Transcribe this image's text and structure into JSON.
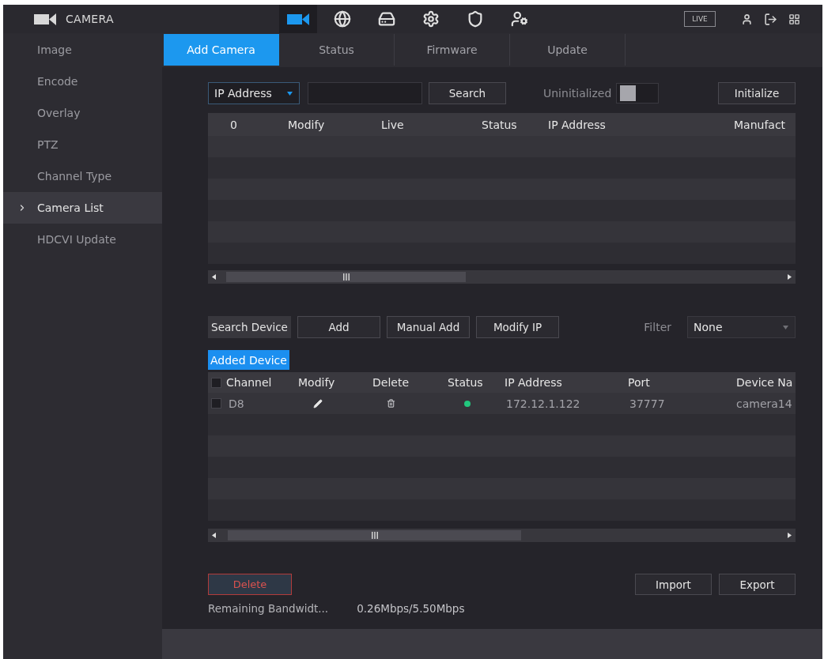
{
  "top_bar": {
    "title": "CAMERA",
    "nav": [
      {
        "kind": "camera",
        "selected": true
      },
      {
        "kind": "network",
        "selected": false
      },
      {
        "kind": "storage",
        "selected": false
      },
      {
        "kind": "system",
        "selected": false
      },
      {
        "kind": "security",
        "selected": false
      },
      {
        "kind": "account",
        "selected": false
      }
    ],
    "live_button": "LIVE"
  },
  "sidebar": {
    "items": [
      {
        "label": "Image",
        "selected": false
      },
      {
        "label": "Encode",
        "selected": false
      },
      {
        "label": "Overlay",
        "selected": false
      },
      {
        "label": "PTZ",
        "selected": false
      },
      {
        "label": "Channel Type",
        "selected": false
      },
      {
        "label": "Camera List",
        "selected": true
      },
      {
        "label": "HDCVI Update",
        "selected": false
      }
    ]
  },
  "tabs": [
    {
      "label": "Add Camera",
      "selected": true
    },
    {
      "label": "Status",
      "selected": false
    },
    {
      "label": "Firmware",
      "selected": false
    },
    {
      "label": "Update",
      "selected": false
    }
  ],
  "search_bar": {
    "search_type": "IP Address",
    "search_button": "Search",
    "uninitialized_toggle": {
      "label": "Uninitialized",
      "on": false
    },
    "initialize_button": "Initialize"
  },
  "found_devices_table": {
    "columns": [
      "0",
      "Modify",
      "Live",
      "Status",
      "IP Address",
      "Manufact"
    ]
  },
  "device_actions": {
    "buttons": [
      {
        "label": "Search Device",
        "kind": "flat"
      },
      {
        "label": "Add",
        "kind": "outlined"
      },
      {
        "label": "Manual Add",
        "kind": "outlined"
      },
      {
        "label": "Modify IP",
        "kind": "outlined"
      }
    ],
    "filter": {
      "label": "Filter",
      "value": "None"
    }
  },
  "added_device": {
    "title": "Added Device",
    "highlighted": true,
    "header_checked": false,
    "columns": [
      "Channel",
      "Modify",
      "Delete",
      "Status",
      "IP Address",
      "Port",
      "Device Na"
    ],
    "rows": [
      {
        "checked": false,
        "channel": "D8",
        "online": true,
        "ip_address": "172.12.1.122",
        "port": "37777",
        "device_name": "camera14"
      }
    ]
  },
  "footer": {
    "delete_button": "Delete",
    "import_button": "Import",
    "export_button": "Export",
    "bandwidth_label": "Remaining Bandwidt...",
    "bandwidth_value": "0.26Mbps/5.50Mbps"
  }
}
